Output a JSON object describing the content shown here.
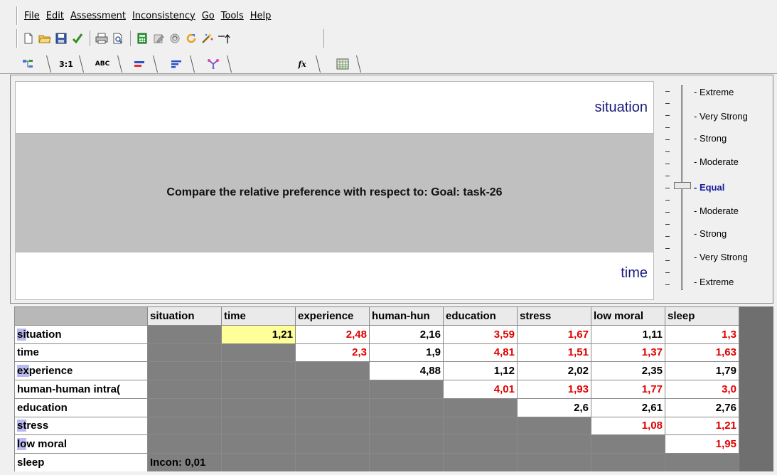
{
  "menu": [
    "File",
    "Edit",
    "Assessment",
    "Inconsistency",
    "Go",
    "Tools",
    "Help"
  ],
  "toolbar": {
    "icons": [
      "new-document-icon",
      "open-folder-icon",
      "save-disk-icon",
      "green-check-icon",
      "print-icon",
      "print-preview-icon",
      "calculator-icon",
      "edit-icon",
      "recycle-icon",
      "refresh-icon",
      "wand-icon",
      "arrow-up-icon"
    ]
  },
  "tabs": [
    {
      "name": "tab-tree",
      "label": "☷"
    },
    {
      "name": "tab-ratio",
      "label": "3:1"
    },
    {
      "name": "tab-verbal",
      "label": "ABC"
    },
    {
      "name": "tab-bar",
      "label": "━"
    },
    {
      "name": "tab-bars",
      "label": "≡"
    },
    {
      "name": "tab-network",
      "label": "✦"
    },
    {
      "name": "tab-formula",
      "label": "fx"
    },
    {
      "name": "tab-matrix",
      "label": "▦"
    }
  ],
  "compare": {
    "top_criterion": "situation",
    "bottom_criterion": "time",
    "question": "Compare the relative preference with respect to: Goal: task-26"
  },
  "scale": {
    "labels": [
      "Extreme",
      "Very Strong",
      "Strong",
      "Moderate",
      "Equal",
      "Moderate",
      "Strong",
      "Very Strong",
      "Extreme"
    ],
    "selected": "Equal"
  },
  "matrix": {
    "columns": [
      "situation",
      "time",
      "experience",
      "human-hun",
      "education",
      "stress",
      "low moral",
      "sleep"
    ],
    "rows": [
      {
        "label": "situation",
        "hl": "si",
        "rest": "tuation"
      },
      {
        "label": "time",
        "hl": "",
        "rest": "time"
      },
      {
        "label": "experience",
        "hl": "ex",
        "rest": "perience"
      },
      {
        "label": "human-human intra(",
        "hl": "",
        "rest": "human-human intra("
      },
      {
        "label": "education",
        "hl": "",
        "rest": "education"
      },
      {
        "label": "stress",
        "hl": "st",
        "rest": "ress"
      },
      {
        "label": "low moral",
        "hl": "lo",
        "rest": "w moral"
      },
      {
        "label": "sleep",
        "hl": "",
        "rest": "sleep"
      }
    ],
    "cells": [
      [
        null,
        "1,21",
        "2,48",
        "2,16",
        "3,59",
        "1,67",
        "1,11",
        "1,3"
      ],
      [
        null,
        null,
        "2,3",
        "1,9",
        "4,81",
        "1,51",
        "1,37",
        "1,63"
      ],
      [
        null,
        null,
        null,
        "4,88",
        "1,12",
        "2,02",
        "2,35",
        "1,79"
      ],
      [
        null,
        null,
        null,
        null,
        "4,01",
        "1,93",
        "1,77",
        "3,0"
      ],
      [
        null,
        null,
        null,
        null,
        null,
        "2,6",
        "2,61",
        "2,76"
      ],
      [
        null,
        null,
        null,
        null,
        null,
        null,
        "1,08",
        "1,21"
      ],
      [
        null,
        null,
        null,
        null,
        null,
        null,
        null,
        "1,95"
      ],
      [
        null,
        null,
        null,
        null,
        null,
        null,
        null,
        null
      ]
    ],
    "red_cells": [
      [
        0,
        2
      ],
      [
        0,
        4
      ],
      [
        0,
        5
      ],
      [
        0,
        7
      ],
      [
        1,
        2
      ],
      [
        1,
        4
      ],
      [
        1,
        5
      ],
      [
        1,
        6
      ],
      [
        1,
        7
      ],
      [
        3,
        4
      ],
      [
        3,
        5
      ],
      [
        3,
        6
      ],
      [
        3,
        7
      ],
      [
        5,
        6
      ],
      [
        5,
        7
      ],
      [
        6,
        7
      ]
    ],
    "selected_cell": [
      0,
      1
    ],
    "inconsistency": "Incon: 0,01"
  },
  "colors": {
    "red_value": "#e00000",
    "selected_cell": "#ffff99",
    "row_highlight": "#b9b9f2",
    "criterion_label": "#1a1a7a",
    "equal_label": "#1a1a9a"
  }
}
